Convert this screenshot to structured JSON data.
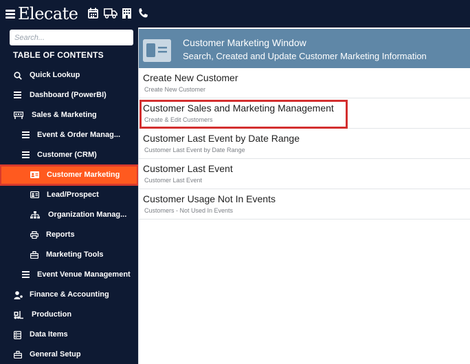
{
  "app": {
    "logo_text": "Elecate"
  },
  "topbar_icons": [
    "calendar-icon",
    "truck-icon",
    "building-icon",
    "phone-icon"
  ],
  "sidebar": {
    "search_placeholder": "Search...",
    "toc_title": "TABLE OF CONTENTS",
    "items": [
      {
        "label": "Quick Lookup",
        "icon": "search-icon",
        "level": 0
      },
      {
        "label": "Dashboard (PowerBI)",
        "icon": "list-icon",
        "level": 0
      },
      {
        "label": "Sales & Marketing",
        "icon": "sales-icon",
        "level": 0
      },
      {
        "label": "Event & Order Manag...",
        "icon": "list-icon",
        "level": 1
      },
      {
        "label": "Customer (CRM)",
        "icon": "list-icon",
        "level": 1
      },
      {
        "label": "Customer Marketing",
        "icon": "id-card-icon",
        "level": 2,
        "active": true
      },
      {
        "label": "Lead/Prospect",
        "icon": "id-card-icon",
        "level": 2
      },
      {
        "label": "Organization Manag...",
        "icon": "org-chart-icon",
        "level": 2
      },
      {
        "label": "Reports",
        "icon": "printer-icon",
        "level": 2
      },
      {
        "label": "Marketing Tools",
        "icon": "toolbox-icon",
        "level": 2
      },
      {
        "label": "Event Venue Management",
        "icon": "list-icon",
        "level": 1
      },
      {
        "label": "Finance & Accounting",
        "icon": "finance-icon",
        "level": 0
      },
      {
        "label": "Production",
        "icon": "forklift-icon",
        "level": 0
      },
      {
        "label": "Data Items",
        "icon": "data-icon",
        "level": 0
      },
      {
        "label": "General Setup",
        "icon": "toolbox-icon",
        "level": 0
      }
    ]
  },
  "colors": {
    "nav_bg": "#0e1a33",
    "active_bg": "#ff5a1f",
    "header_bg": "#5f87a7",
    "highlight_border": "#d32f2f"
  },
  "main": {
    "header": {
      "title": "Customer Marketing Window",
      "subtitle": "Search, Created and Update Customer Marketing Information"
    },
    "rows": [
      {
        "title": "Create New Customer",
        "subtitle": "Create New Customer"
      },
      {
        "title": "Customer Sales and Marketing Management",
        "subtitle": "Create & Edit Customers",
        "highlighted": true
      },
      {
        "title": "Customer Last Event by Date Range",
        "subtitle": "Customer Last Event by Date Range"
      },
      {
        "title": "Customer Last Event",
        "subtitle": "Customer Last Event"
      },
      {
        "title": "Customer Usage Not In Events",
        "subtitle": "Customers - Not Used In Events"
      }
    ]
  }
}
